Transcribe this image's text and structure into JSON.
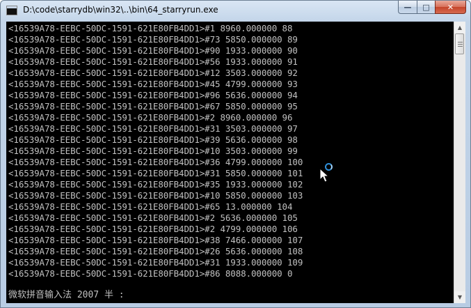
{
  "window": {
    "title": "D:\\code\\starrydb\\win32\\..\\bin\\64_starryrun.exe",
    "buttons": {
      "minimize": "—",
      "maximize": "□",
      "close": "✕"
    }
  },
  "console": {
    "lines": [
      "<16539A78-EEBC-50DC-1591-621E80FB4DD1>#1 8960.000000 88",
      "<16539A78-EEBC-50DC-1591-621E80FB4DD1>#73 5850.000000 89",
      "<16539A78-EEBC-50DC-1591-621E80FB4DD1>#90 1933.000000 90",
      "<16539A78-EEBC-50DC-1591-621E80FB4DD1>#56 1933.000000 91",
      "<16539A78-EEBC-50DC-1591-621E80FB4DD1>#12 3503.000000 92",
      "<16539A78-EEBC-50DC-1591-621E80FB4DD1>#45 4799.000000 93",
      "<16539A78-EEBC-50DC-1591-621E80FB4DD1>#96 5636.000000 94",
      "<16539A78-EEBC-50DC-1591-621E80FB4DD1>#67 5850.000000 95",
      "<16539A78-EEBC-50DC-1591-621E80FB4DD1>#2 8960.000000 96",
      "<16539A78-EEBC-50DC-1591-621E80FB4DD1>#31 3503.000000 97",
      "<16539A78-EEBC-50DC-1591-621E80FB4DD1>#39 5636.000000 98",
      "<16539A78-EEBC-50DC-1591-621E80FB4DD1>#10 3503.000000 99",
      "<16539A78-EEBC-50DC-1591-621E80FB4DD1>#36 4799.000000 100",
      "<16539A78-EEBC-50DC-1591-621E80FB4DD1>#31 5850.000000 101",
      "<16539A78-EEBC-50DC-1591-621E80FB4DD1>#35 1933.000000 102",
      "<16539A78-EEBC-50DC-1591-621E80FB4DD1>#10 5850.000000 103",
      "<16539A78-EEBC-50DC-1591-621E80FB4DD1>#65 13.000000 104",
      "<16539A78-EEBC-50DC-1591-621E80FB4DD1>#2 5636.000000 105",
      "<16539A78-EEBC-50DC-1591-621E80FB4DD1>#2 4799.000000 106",
      "<16539A78-EEBC-50DC-1591-621E80FB4DD1>#38 7466.000000 107",
      "<16539A78-EEBC-50DC-1591-621E80FB4DD1>#26 5636.000000 108",
      "<16539A78-EEBC-50DC-1591-621E80FB4DD1>#31 1933.000000 109",
      "<16539A78-EEBC-50DC-1591-621E80FB4DD1>#86 8088.000000 0"
    ],
    "ime_status": "微软拼音输入法 2007 半 :"
  },
  "scrollbar": {
    "up_arrow": "▲",
    "down_arrow": "▼"
  },
  "colors": {
    "console_background": "#000000",
    "console_text": "#c0c0c0",
    "close_button": "#c4442a"
  },
  "icons": {
    "app": "console-icon",
    "cursor": "busy-pointer-icon"
  }
}
